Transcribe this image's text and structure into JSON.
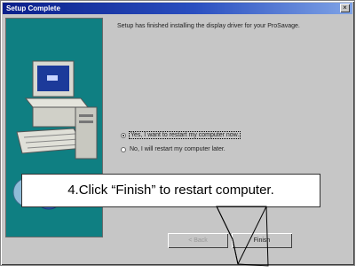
{
  "window": {
    "title": "Setup Complete",
    "close_glyph": "×"
  },
  "content": {
    "message": "Setup has finished installing the display driver for your ProSavage."
  },
  "options": [
    {
      "label": "Yes, I want to restart my computer now.",
      "checked": true
    },
    {
      "label": "No, I will restart my computer later.",
      "checked": false
    }
  ],
  "callout": {
    "text": "4.Click “Finish” to restart computer."
  },
  "buttons": {
    "back": "< Back",
    "finish": "Finish"
  },
  "colors": {
    "panel": "#0f7f82",
    "titlebar": "#0a1f8a",
    "dialog": "#c6c6c6"
  },
  "icons": [
    "close-icon",
    "computer-icon",
    "cd-icon"
  ]
}
